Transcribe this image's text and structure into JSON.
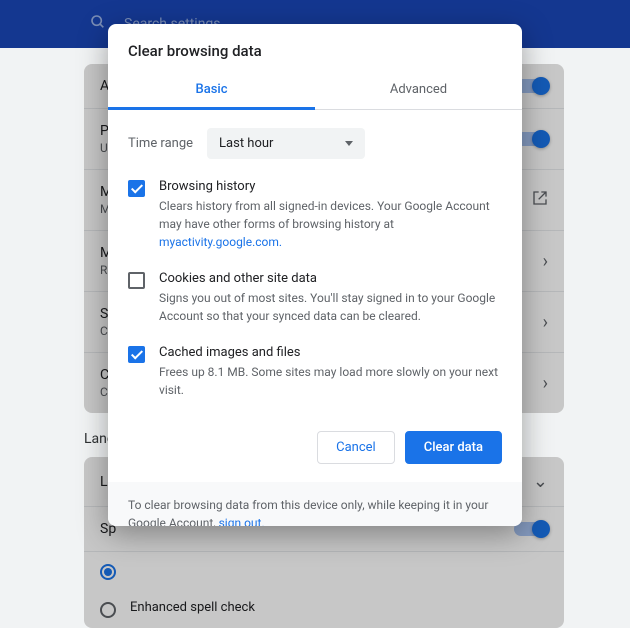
{
  "bg": {
    "search_placeholder": "Search settings",
    "rows": [
      "All",
      "Pr",
      "M",
      "M",
      "Si",
      "Cl"
    ],
    "subs": [
      "",
      "Us",
      "Mi",
      "Re",
      "Co",
      "Cl"
    ],
    "section2": "Langu",
    "rows2": [
      "La",
      "Sp"
    ],
    "radio1": "",
    "radio2": "Enhanced spell check"
  },
  "dialog": {
    "title": "Clear browsing data",
    "tabs": {
      "basic": "Basic",
      "advanced": "Advanced"
    },
    "time_label": "Time range",
    "time_value": "Last hour",
    "items": [
      {
        "title": "Browsing history",
        "desc": "Clears history from all signed-in devices. Your Google Account may have other forms of browsing history at ",
        "link": "myactivity.google.com."
      },
      {
        "title": "Cookies and other site data",
        "desc": "Signs you out of most sites. You'll stay signed in to your Google Account so that your synced data can be cleared."
      },
      {
        "title": "Cached images and files",
        "desc": "Frees up 8.1 MB. Some sites may load more slowly on your next visit."
      }
    ],
    "cancel": "Cancel",
    "clear": "Clear data",
    "footer_text": "To clear browsing data from this device only, while keeping it in your Google Account, ",
    "footer_link": "sign out."
  }
}
